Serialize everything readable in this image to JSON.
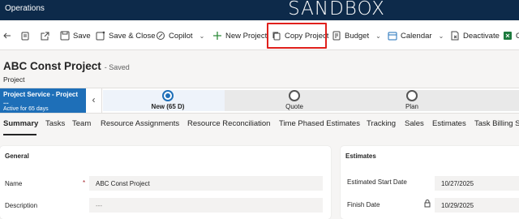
{
  "app": {
    "name": "Operations",
    "environment": "SANDBOX"
  },
  "commands": {
    "save": "Save",
    "save_close": "Save & Close",
    "copilot": "Copilot",
    "new_project": "New Project",
    "copy_project": "Copy Project",
    "budget": "Budget",
    "calendar": "Calendar",
    "deactivate": "Deactivate",
    "overflow": "O"
  },
  "record": {
    "title": "ABC Const Project",
    "save_status": "- Saved",
    "entity": "Project"
  },
  "process": {
    "name": "Project Service - Project ...",
    "status": "Active for 65 days",
    "stages": [
      {
        "label": "New  (65 D)",
        "active": true
      },
      {
        "label": "Quote",
        "active": false
      },
      {
        "label": "Plan",
        "active": false
      }
    ]
  },
  "tabs": [
    "Summary",
    "Tasks",
    "Team",
    "Resource Assignments",
    "Resource Reconciliation",
    "Time Phased Estimates",
    "Tracking",
    "Sales",
    "Estimates",
    "Task Billing Se"
  ],
  "general": {
    "heading": "General",
    "name_label": "Name",
    "required_mark": "*",
    "name_value": "ABC Const Project",
    "description_label": "Description",
    "description_value": "---"
  },
  "estimates": {
    "heading": "Estimates",
    "start_label": "Estimated Start Date",
    "start_value": "10/27/2025",
    "finish_label": "Finish Date",
    "finish_value": "10/29/2025"
  },
  "colors": {
    "topbar": "#0d2a4a",
    "process_active": "#1e6fb8",
    "highlight": "#e0201c"
  }
}
